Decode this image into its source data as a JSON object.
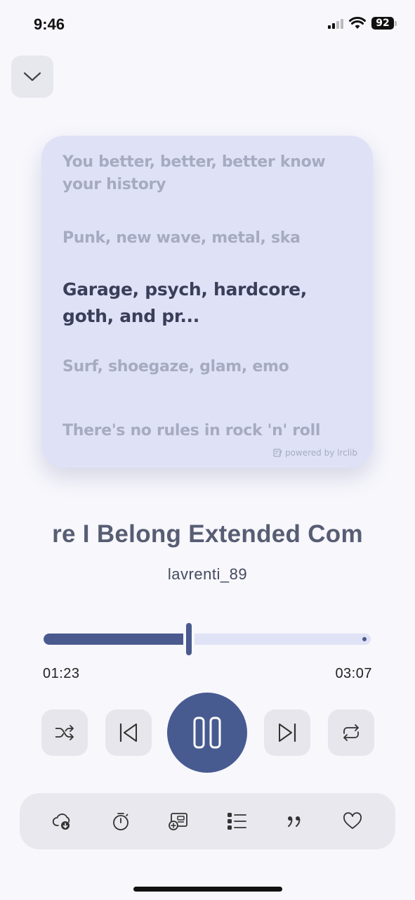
{
  "status_bar": {
    "time": "9:46",
    "battery": "92"
  },
  "lyrics": {
    "lines": [
      "You better, better, better know your history",
      "Punk, new wave, metal, ska",
      "Garage, psych, hardcore, goth, and pr...",
      "Surf, shoegaze, glam, emo",
      "There's no rules in rock 'n' roll"
    ],
    "active_index": 2,
    "powered_by": "powered by lrclib"
  },
  "track": {
    "title": "re I Belong Extended Com",
    "artist": "lavrenti_89",
    "elapsed": "01:23",
    "duration": "03:07",
    "progress": 0.445
  },
  "controls": {
    "shuffle_icon": "shuffle-icon",
    "previous_icon": "skip-previous-icon",
    "play_state_icon": "pause-icon",
    "next_icon": "skip-next-icon",
    "repeat_icon": "repeat-icon"
  },
  "toolbar": {
    "items": [
      "cloud-download-icon",
      "timer-icon",
      "add-to-playlist-icon",
      "queue-list-icon",
      "lyrics-quote-icon",
      "heart-icon"
    ]
  },
  "colors": {
    "accent": "#485b90",
    "lyrics_card": "#dfe2f7",
    "inactive_lyric": "#a6abc2",
    "active_lyric": "#3a3e58"
  }
}
